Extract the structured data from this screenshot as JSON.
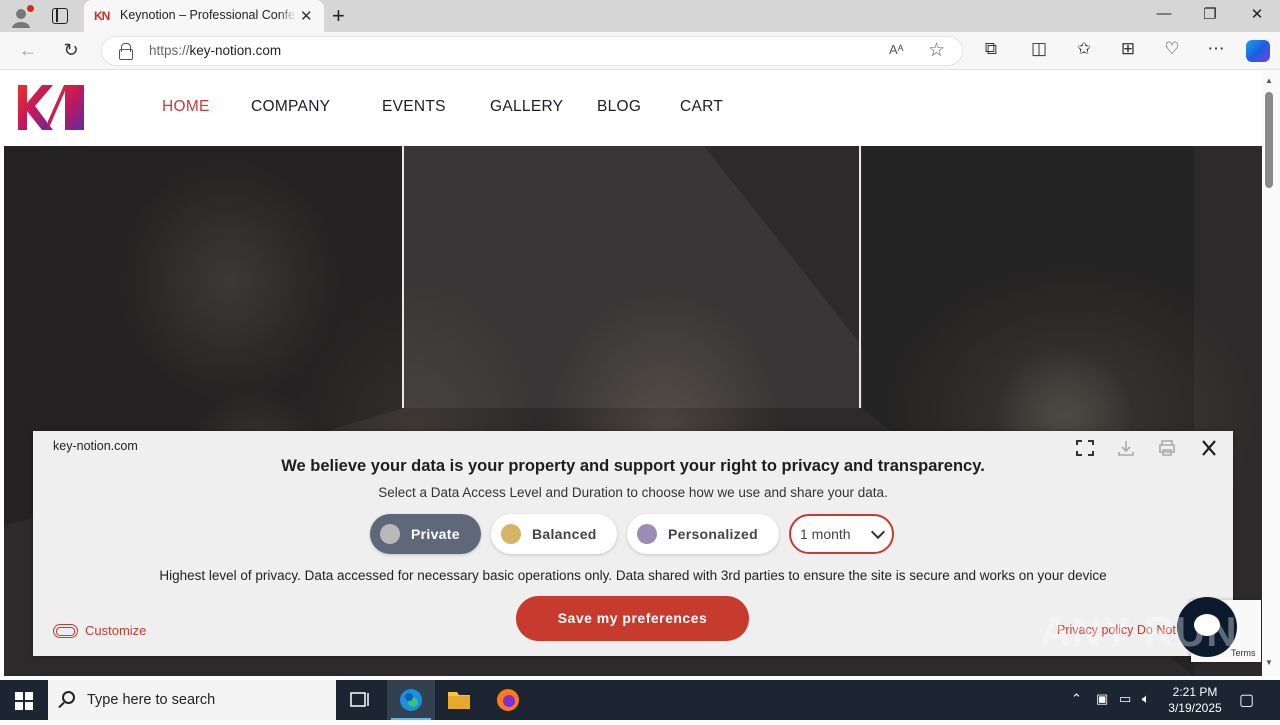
{
  "browser": {
    "tab_title": "Keynotion – Professional Conference",
    "tab_favicon": "KN",
    "url_prefix": "https://",
    "url_host": "key-notion.com",
    "read_aloud": "Aᴬ"
  },
  "site": {
    "nav": [
      {
        "label": "HOME",
        "active": true
      },
      {
        "label": "COMPANY"
      },
      {
        "label": "EVENTS"
      },
      {
        "label": "GALLERY"
      },
      {
        "label": "BLOG"
      },
      {
        "label": "CART"
      }
    ]
  },
  "consent": {
    "domain": "key-notion.com",
    "heading": "We believe your data is your property and support your right to privacy and transparency.",
    "subheading": "Select a Data Access Level and Duration to choose how we use and share your data.",
    "levels": [
      {
        "label": "Private",
        "selected": true,
        "color": "#b9b9b9"
      },
      {
        "label": "Balanced",
        "color": "#d4b565"
      },
      {
        "label": "Personalized",
        "color": "#9b8cb3"
      }
    ],
    "duration": "1 month",
    "description": "Highest level of privacy. Data accessed for necessary basic operations only. Data shared with 3rd parties to ensure the site is secure and works on your device",
    "save_label": "Save my preferences",
    "customize_label": "Customize",
    "links": "Privacy policy   Do Not Sell",
    "accent": "#c63b2e"
  },
  "recaptcha": {
    "terms": "Terms"
  },
  "watermark": "ANY RUN",
  "taskbar": {
    "search_placeholder": "Type here to search",
    "time": "2:21 PM",
    "date": "3/19/2025"
  }
}
